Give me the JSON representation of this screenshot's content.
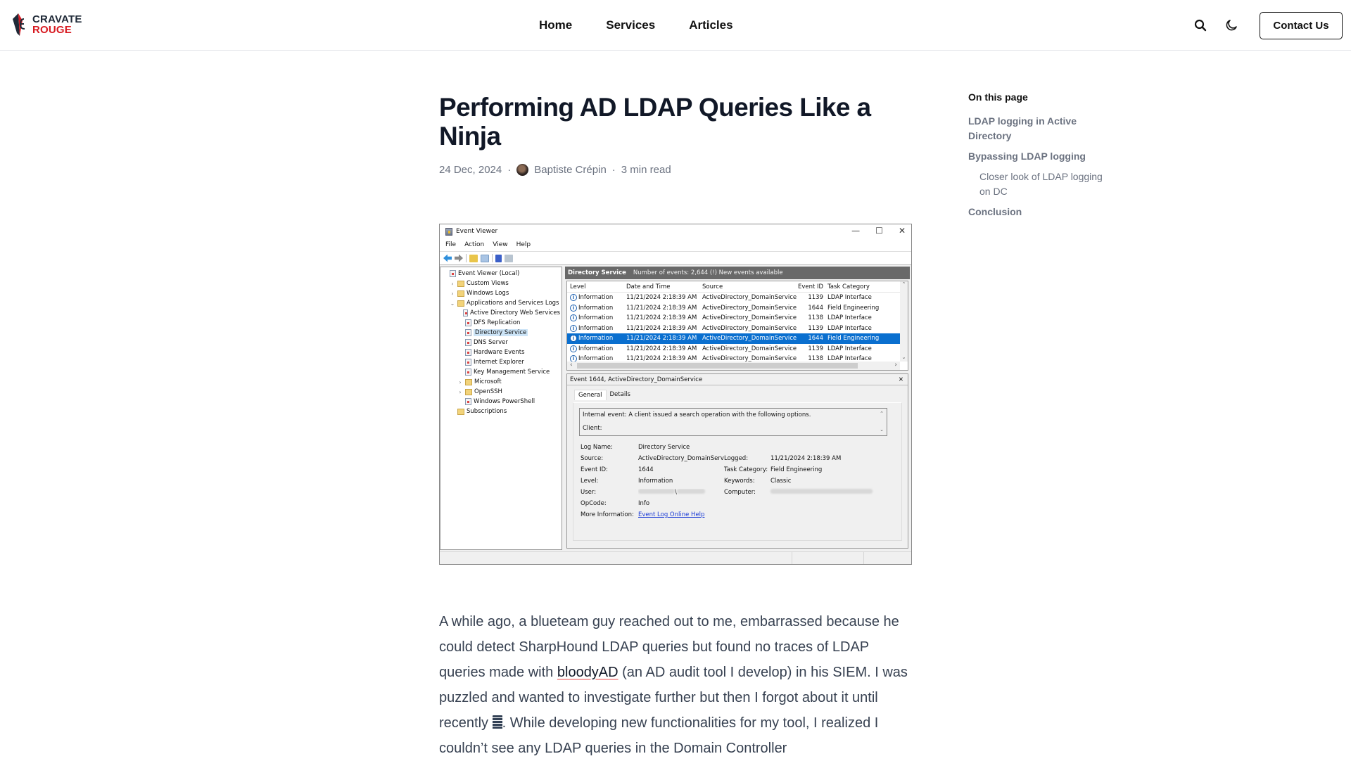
{
  "header": {
    "logo": {
      "line1": "CRAVATE",
      "line2": "ROUGE",
      "icon": "cravate-tie-logo-icon"
    },
    "nav": [
      {
        "label": "Home"
      },
      {
        "label": "Services"
      },
      {
        "label": "Articles"
      }
    ],
    "search_icon": "search-icon",
    "theme_icon": "moon-icon",
    "contact_label": "Contact Us"
  },
  "article": {
    "title": "Performing AD LDAP Queries Like a Ninja",
    "date": "24 Dec, 2024",
    "separator": "·",
    "author": "Baptiste Crépin",
    "read_time": "3 min read",
    "paragraph": {
      "before_link": "A while ago, a blueteam guy reached out to me, embarrassed because he could detect SharpHound LDAP queries but found no traces of LDAP queries made with ",
      "link_text": "bloodyAD",
      "after_link": " (an AD audit tool I develop) in his SIEM. I was puzzled and wanted to investigate further but then I forgot about it until recently ",
      "emoji": "notebook-emoji",
      "after_emoji": ". While developing new functionalities for my tool, I realized I couldn’t see any LDAP queries in the Domain Controller"
    }
  },
  "toc": {
    "heading": "On this page",
    "items": [
      {
        "label": "LDAP logging in Active Directory",
        "level": 1
      },
      {
        "label": "Bypassing LDAP logging",
        "level": 1
      },
      {
        "label": "Closer look of LDAP logging on DC",
        "level": 2
      },
      {
        "label": "Conclusion",
        "level": 1
      }
    ]
  },
  "event_viewer": {
    "window_title": "Event Viewer",
    "window_controls": [
      "—",
      "☐",
      "✕"
    ],
    "menu": [
      "File",
      "Action",
      "View",
      "Help"
    ],
    "tree": [
      {
        "label": "Event Viewer (Local)",
        "indent": 0,
        "chev": "",
        "icon": "log"
      },
      {
        "label": "Custom Views",
        "indent": 1,
        "chev": ">",
        "icon": "folder"
      },
      {
        "label": "Windows Logs",
        "indent": 1,
        "chev": ">",
        "icon": "folder"
      },
      {
        "label": "Applications and Services Logs",
        "indent": 1,
        "chev": "v",
        "icon": "folder"
      },
      {
        "label": "Active Directory Web Services",
        "indent": 2,
        "chev": "",
        "icon": "log"
      },
      {
        "label": "DFS Replication",
        "indent": 2,
        "chev": "",
        "icon": "log"
      },
      {
        "label": "Directory Service",
        "indent": 2,
        "chev": "",
        "icon": "log",
        "selected": true
      },
      {
        "label": "DNS Server",
        "indent": 2,
        "chev": "",
        "icon": "log"
      },
      {
        "label": "Hardware Events",
        "indent": 2,
        "chev": "",
        "icon": "log"
      },
      {
        "label": "Internet Explorer",
        "indent": 2,
        "chev": "",
        "icon": "log"
      },
      {
        "label": "Key Management Service",
        "indent": 2,
        "chev": "",
        "icon": "log"
      },
      {
        "label": "Microsoft",
        "indent": 2,
        "chev": ">",
        "icon": "folder"
      },
      {
        "label": "OpenSSH",
        "indent": 2,
        "chev": ">",
        "icon": "folder"
      },
      {
        "label": "Windows PowerShell",
        "indent": 2,
        "chev": "",
        "icon": "log"
      },
      {
        "label": "Subscriptions",
        "indent": 1,
        "chev": "",
        "icon": "folder"
      }
    ],
    "log_name": "Directory Service",
    "log_info": "Number of events: 2,644 (!) New events available",
    "columns": [
      "Level",
      "Date and Time",
      "Source",
      "Event ID",
      "Task Category"
    ],
    "rows": [
      {
        "level": "Information",
        "date": "11/21/2024 2:18:39 AM",
        "source": "ActiveDirectory_DomainService",
        "id": "1139",
        "category": "LDAP Interface"
      },
      {
        "level": "Information",
        "date": "11/21/2024 2:18:39 AM",
        "source": "ActiveDirectory_DomainService",
        "id": "1644",
        "category": "Field Engineering"
      },
      {
        "level": "Information",
        "date": "11/21/2024 2:18:39 AM",
        "source": "ActiveDirectory_DomainService",
        "id": "1138",
        "category": "LDAP Interface"
      },
      {
        "level": "Information",
        "date": "11/21/2024 2:18:39 AM",
        "source": "ActiveDirectory_DomainService",
        "id": "1139",
        "category": "LDAP Interface"
      },
      {
        "level": "Information",
        "date": "11/21/2024 2:18:39 AM",
        "source": "ActiveDirectory_DomainService",
        "id": "1644",
        "category": "Field Engineering",
        "selected": true
      },
      {
        "level": "Information",
        "date": "11/21/2024 2:18:39 AM",
        "source": "ActiveDirectory_DomainService",
        "id": "1139",
        "category": "LDAP Interface"
      },
      {
        "level": "Information",
        "date": "11/21/2024 2:18:39 AM",
        "source": "ActiveDirectory_DomainService",
        "id": "1138",
        "category": "LDAP Interface"
      }
    ],
    "detail": {
      "header": "Event 1644, ActiveDirectory_DomainService",
      "tabs": [
        "General",
        "Details"
      ],
      "message_line1": "Internal event: A client issued a search operation with the following options.",
      "message_line2": "Client:",
      "props": {
        "log_name_label": "Log Name:",
        "log_name": "Directory Service",
        "source_label": "Source:",
        "source": "ActiveDirectory_DomainServ",
        "logged_label": "Logged:",
        "logged": "11/21/2024 2:18:39 AM",
        "event_id_label": "Event ID:",
        "event_id": "1644",
        "task_label": "Task Category:",
        "task": "Field Engineering",
        "level_label": "Level:",
        "level": "Information",
        "keywords_label": "Keywords:",
        "keywords": "Classic",
        "user_label": "User:",
        "user_sep": "\\",
        "computer_label": "Computer:",
        "opcode_label": "OpCode:",
        "opcode": "Info",
        "more_label": "More Information:",
        "more_link": "Event Log Online Help"
      }
    }
  }
}
